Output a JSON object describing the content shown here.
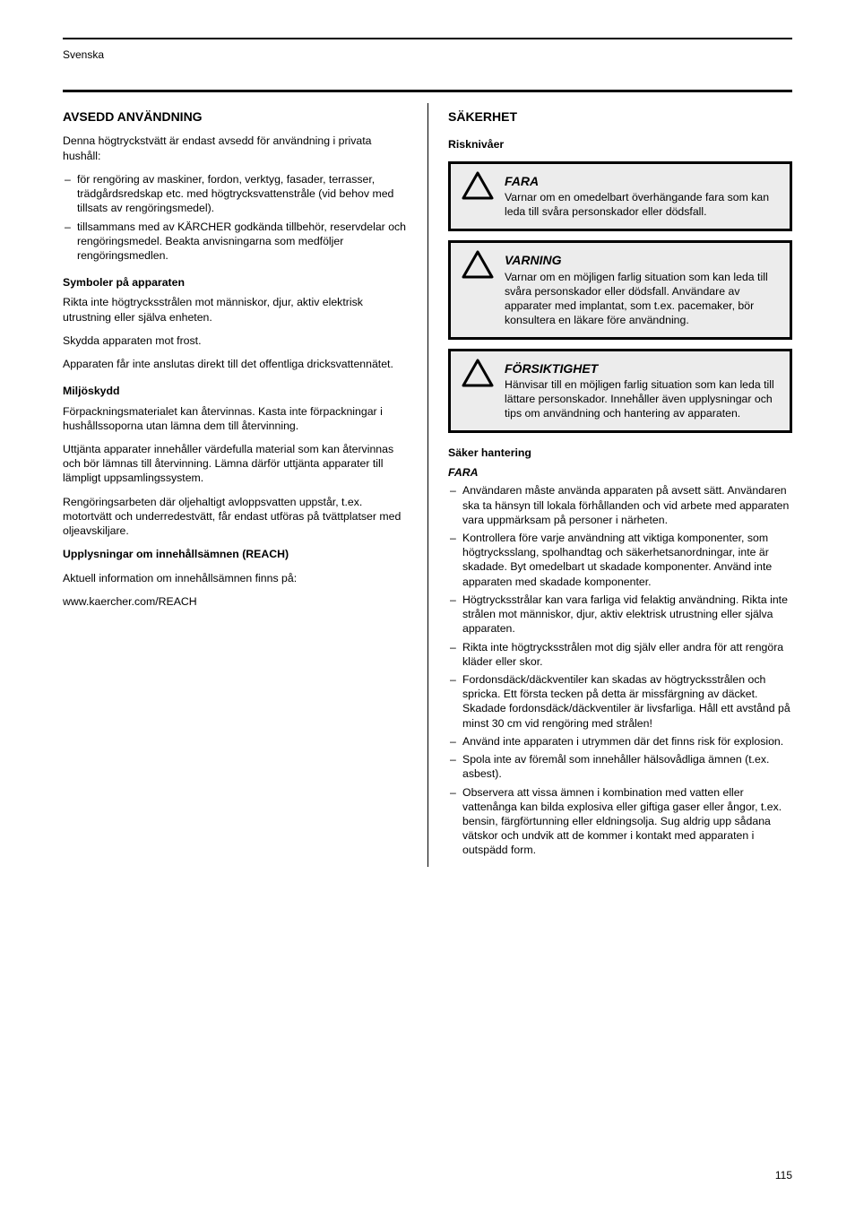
{
  "header": {
    "label": "Svenska"
  },
  "page_number": "115",
  "left": {
    "title": "AVSEDD ANVÄNDNING",
    "p1": "Denna högtryckstvätt är endast avsedd för användning i privata hushåll:",
    "li1": "för rengöring av maskiner, fordon, verktyg, fasader, terrasser, trädgårdsredskap etc. med högtrycksvattenstråle (vid behov med tillsats av rengöringsmedel).",
    "li2": "tillsammans med av KÄRCHER godkända tillbehör, reservdelar och rengöringsmedel. Beakta anvisningarna som medföljer rengöringsmedlen.",
    "sub1": "Symboler på apparaten",
    "p2": "Rikta inte högtrycksstrålen mot människor, djur, aktiv elektrisk utrustning eller själva enheten.",
    "p3": "Skydda apparaten mot frost.",
    "p4": "Apparaten får inte anslutas direkt till det offentliga dricksvattennätet.",
    "sub2": "Miljöskydd",
    "p5": "Förpackningsmaterialet kan återvinnas. Kasta inte förpackningar i hushållssoporna utan lämna dem till återvinning.",
    "p6": "Uttjänta apparater innehåller värdefulla material som kan återvinnas och bör lämnas till återvinning. Lämna därför uttjänta apparater till lämpligt uppsamlingssystem.",
    "p7": "Rengöringsarbeten där oljehaltigt avloppsvatten uppstår, t.ex. motortvätt och underredestvätt, får endast utföras på tvättplatser med oljeavskiljare.",
    "noteLabel": "Upplysningar om innehållsämnen (REACH)",
    "p8": "Aktuell information om innehållsämnen finns på:",
    "p9": "www.kaercher.com/REACH"
  },
  "right": {
    "title": "SÄKERHET",
    "sub1": "Risknivåer",
    "warn1": {
      "title": "FARA",
      "text": "Varnar om en omedelbart överhängande fara som kan leda till svåra personskador eller dödsfall."
    },
    "warn2": {
      "title": "VARNING",
      "text": "Varnar om en möjligen farlig situation som kan leda till svåra personskador eller dödsfall. Användare av apparater med implantat, som t.ex. pacemaker, bör konsultera en läkare före användning."
    },
    "warn3": {
      "title": "FÖRSIKTIGHET",
      "text": "Hänvisar till en möjligen farlig situation som kan leda till lättare personskador. Innehåller även upplysningar och tips om användning och hantering av apparaten."
    },
    "sub2": "Säker hantering",
    "dangerHead": "FARA",
    "li1": "Användaren måste använda apparaten på avsett sätt. Användaren ska ta hänsyn till lokala förhållanden och vid arbete med apparaten vara uppmärksam på personer i närheten.",
    "li2": "Kontrollera före varje användning att viktiga komponenter, som högtrycksslang, spolhandtag och säkerhetsanordningar, inte är skadade. Byt omedelbart ut skadade komponenter. Använd inte apparaten med skadade komponenter.",
    "li3": "Högtrycksstrålar kan vara farliga vid felaktig användning. Rikta inte strålen mot människor, djur, aktiv elektrisk utrustning eller själva apparaten.",
    "li4": "Rikta inte högtrycksstrålen mot dig själv eller andra för att rengöra kläder eller skor.",
    "li5": "Fordonsdäck/däckventiler kan skadas av högtrycksstrålen och spricka. Ett första tecken på detta är missfärgning av däcket. Skadade fordonsdäck/däckventiler är livsfarliga. Håll ett avstånd på minst 30 cm vid rengöring med strålen!",
    "li6": "Använd inte apparaten i utrymmen där det finns risk för explosion.",
    "li7": "Spola inte av föremål som innehåller hälsovådliga ämnen (t.ex. asbest).",
    "li8": "Observera att vissa ämnen i kombination med vatten eller vattenånga kan bilda explosiva eller giftiga gaser eller ångor, t.ex. bensin, färgförtunning eller eldningsolja. Sug aldrig upp sådana vätskor och undvik att de kommer i kontakt med apparaten i outspädd form."
  }
}
